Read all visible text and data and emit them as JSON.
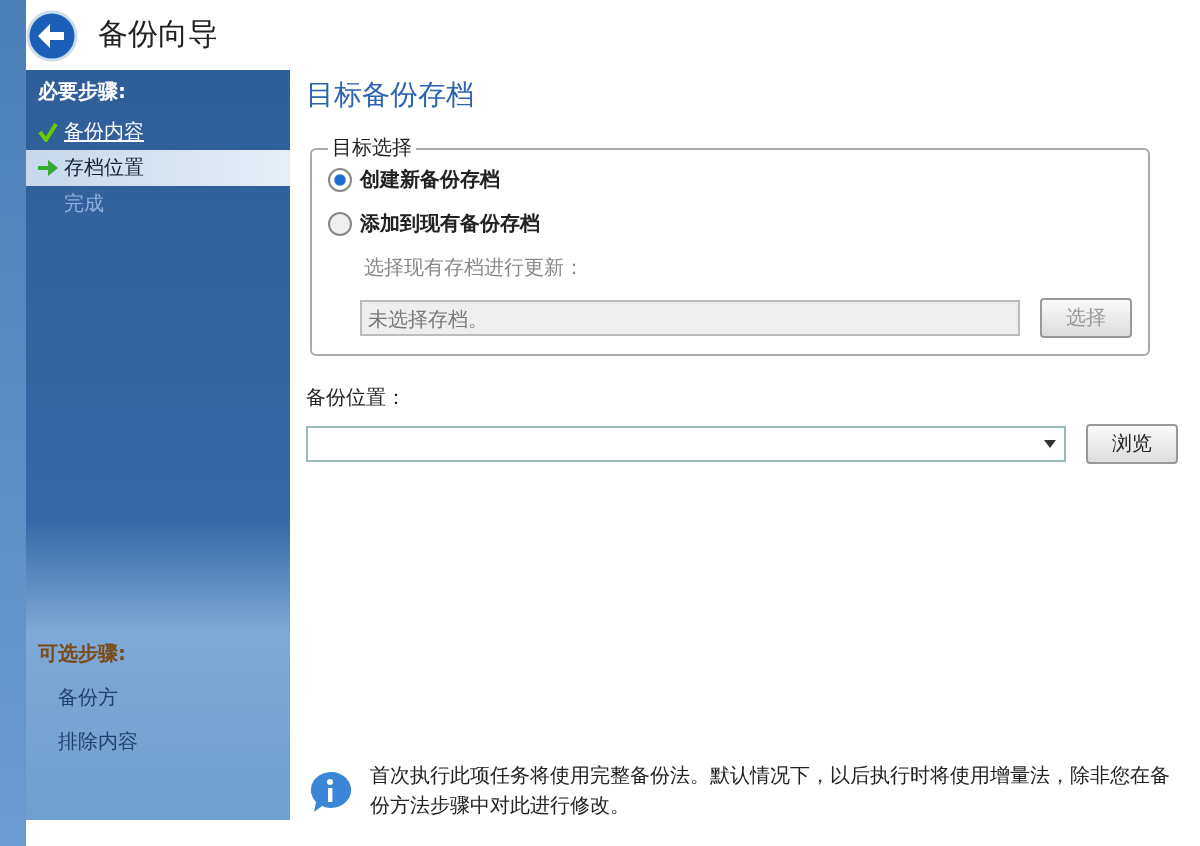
{
  "window": {
    "title": "备份向导"
  },
  "sidebar": {
    "required_heading": "必要步骤:",
    "steps": [
      {
        "label": "备份内容",
        "kind": "done",
        "selected": false
      },
      {
        "label": "存档位置",
        "kind": "current",
        "selected": true
      },
      {
        "label": "完成",
        "kind": "pending",
        "selected": false
      }
    ],
    "optional_heading": "可选步骤:",
    "optional_steps": [
      {
        "label": "备份方"
      },
      {
        "label": "排除内容"
      }
    ]
  },
  "main": {
    "heading": "目标备份存档",
    "target_group": {
      "legend": "目标选择",
      "options": [
        {
          "label": "创建新备份存档",
          "selected": true
        },
        {
          "label": "添加到现有备份存档",
          "selected": false
        }
      ],
      "existing_label": "选择现有存档进行更新：",
      "existing_value": "未选择存档。",
      "select_button": "选择",
      "disabled": true
    },
    "location_label": "备份位置：",
    "browse_button": "浏览",
    "info": "首次执行此项任务将使用完整备份法。默认情况下，以后执行时将使用增量法，除非您在备份方法步骤中对此进行修改。"
  }
}
